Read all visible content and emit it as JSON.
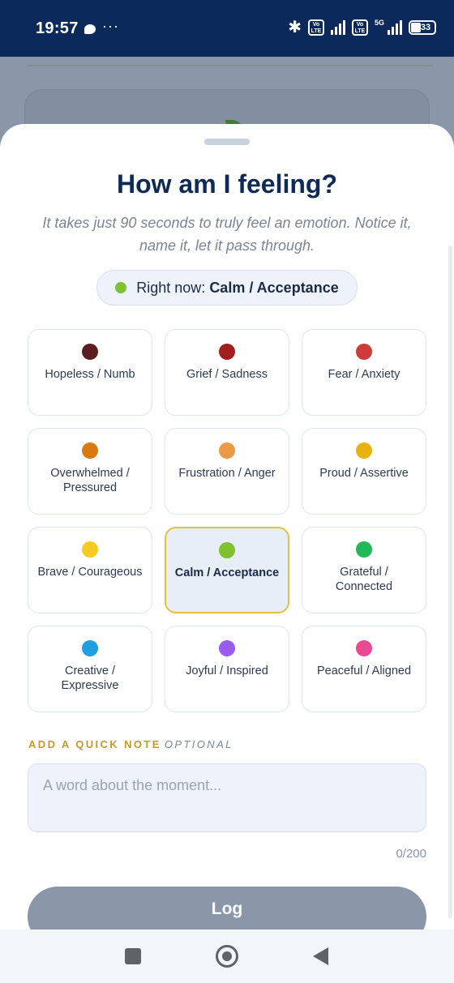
{
  "status_bar": {
    "time": "19:57",
    "dots": "···",
    "volte_label": "Vo LTE",
    "fiveg_label": "5G",
    "battery_level": "33"
  },
  "sheet": {
    "title": "How am I feeling?",
    "subtitle": "It takes just 90 seconds to truly feel an emotion. Notice it, name it, let it pass through.",
    "current_prefix": "Right now:",
    "current_value": "Calm / Acceptance",
    "current_color": "#7fc22f"
  },
  "moods": [
    {
      "label": "Hopeless / Numb",
      "color": "#5a1f1f",
      "selected": false
    },
    {
      "label": "Grief / Sadness",
      "color": "#a11f1f",
      "selected": false
    },
    {
      "label": "Fear / Anxiety",
      "color": "#cf3b3b",
      "selected": false
    },
    {
      "label": "Overwhelmed / Pressured",
      "color": "#d97a0f",
      "selected": false
    },
    {
      "label": "Frustration / Anger",
      "color": "#ec9a45",
      "selected": false
    },
    {
      "label": "Proud / Assertive",
      "color": "#e8b312",
      "selected": false
    },
    {
      "label": "Brave / Courageous",
      "color": "#f6cb1f",
      "selected": false
    },
    {
      "label": "Calm / Acceptance",
      "color": "#7fc22f",
      "selected": true
    },
    {
      "label": "Grateful / Connected",
      "color": "#22b857",
      "selected": false
    },
    {
      "label": "Creative / Expressive",
      "color": "#1f9fe0",
      "selected": false
    },
    {
      "label": "Joyful / Inspired",
      "color": "#9a5cf0",
      "selected": false
    },
    {
      "label": "Peaceful / Aligned",
      "color": "#ea4a94",
      "selected": false
    }
  ],
  "note": {
    "label": "ADD A QUICK NOTE",
    "optional": "OPTIONAL",
    "placeholder": "A word about the moment...",
    "counter": "0/200"
  },
  "log_button": "Log",
  "colors": {
    "primary_text": "#0e2a55",
    "accent": "#c59a25",
    "selected_border": "#e3c23e"
  }
}
